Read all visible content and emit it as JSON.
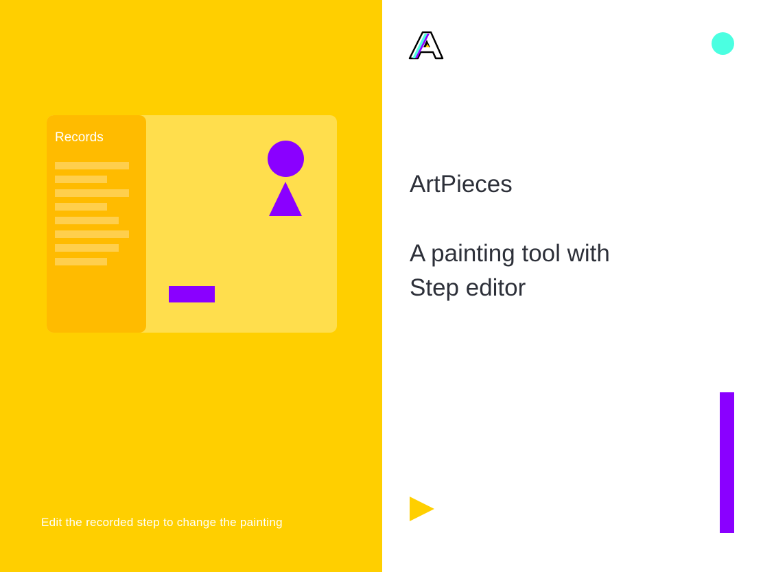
{
  "app": {
    "name": "ArtPieces",
    "logo_icon": "artpieces-a-logo-icon"
  },
  "tagline": {
    "line1": "A painting tool with",
    "line2": "Step editor"
  },
  "mockup": {
    "sidebar_title": "Records",
    "record_count": 8,
    "shapes": [
      "purple-circle",
      "purple-triangle",
      "purple-rectangle"
    ]
  },
  "caption": "Edit the recorded step to change the painting",
  "controls": {
    "play_icon": "play-icon",
    "status_dot_icon": "dot-icon",
    "progress_fraction": 1.0
  },
  "colors": {
    "yellow": "#ffcf00",
    "sidebar_yellow": "#ffbb00",
    "canvas_yellow": "#ffde4d",
    "purple": "#8a00ff",
    "teal": "#4bffe1",
    "text_dark": "#2d3039"
  }
}
